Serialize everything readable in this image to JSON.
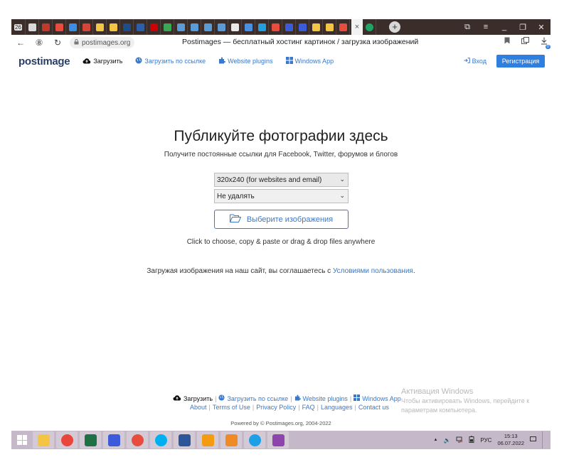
{
  "browser": {
    "tab_counter": "26",
    "tab_close": "×",
    "new_tab": "+",
    "page_title": "Postimages — бесплатный хостинг картинок / загрузка изображений",
    "url": "postimages.org",
    "nav": {
      "back": "←",
      "reader": "⑧",
      "reload": "↻"
    },
    "window_controls": [
      "⧉",
      "≡",
      "_",
      "❐",
      "✕"
    ],
    "tabs": [
      {
        "color": "#d9d9d9"
      },
      {
        "color": "#c0392b"
      },
      {
        "color": "#e74c3c"
      },
      {
        "color": "#3b8ee8"
      },
      {
        "color": "#d44638"
      },
      {
        "color": "#f4c542"
      },
      {
        "color": "#f4c542"
      },
      {
        "color": "#1d4e89"
      },
      {
        "color": "#2b5fa8"
      },
      {
        "color": "#cc0000"
      },
      {
        "color": "#3aa757"
      },
      {
        "color": "#5b9bd5"
      },
      {
        "color": "#5b9bd5"
      },
      {
        "color": "#5b9bd5"
      },
      {
        "color": "#5b9bd5"
      },
      {
        "color": "#e8e8e8"
      },
      {
        "color": "#4a90e2"
      },
      {
        "color": "#20a0e0"
      },
      {
        "color": "#e74c3c"
      },
      {
        "color": "#3b5bdb"
      },
      {
        "color": "#3b5bdb"
      },
      {
        "color": "#f4c542"
      },
      {
        "color": "#f4c542"
      },
      {
        "color": "#e74c3c"
      }
    ],
    "next_tab_color": "#1fa463",
    "reader_bookmark": "🔖",
    "downloads_badge": "0"
  },
  "site": {
    "logo": "postimage",
    "nav": {
      "upload": "Загрузить",
      "upload_by_link": "Загрузить по ссылке",
      "plugins": "Website plugins",
      "windows_app": "Windows App"
    },
    "login": "Вход",
    "register": "Регистрация"
  },
  "main": {
    "headline": "Публикуйте фотографии здесь",
    "subhead": "Получите постоянные ссылки для Facebook, Twitter, форумов и блогов",
    "size_select": "320x240 (for websites and email)",
    "delete_select": "Не удалять",
    "choose_button": "Выберите изображения",
    "drop_hint": "Click to choose, copy & paste or drag & drop files anywhere",
    "terms_prefix": "Загружая изображения на наш сайт, вы соглашаетесь с ",
    "terms_link": "Условиями пользования",
    "terms_suffix": "."
  },
  "footer": {
    "upload": "Загрузить",
    "upload_by_link": "Загрузить по ссылке",
    "plugins": "Website plugins",
    "windows_app": "Windows App",
    "links": [
      "About",
      "Terms of Use",
      "Privacy Policy",
      "FAQ",
      "Languages",
      "Contact us"
    ],
    "powered": "Powered by © Postimages.org, 2004-2022"
  },
  "windows_activation": {
    "title": "Активация Windows",
    "line1": "Чтобы активировать Windows, перейдите к",
    "line2": "параметрам компьютера."
  },
  "taskbar": {
    "apps": [
      {
        "name": "file-explorer",
        "color": "#f4c542"
      },
      {
        "name": "chrome",
        "color": "#e8453c"
      },
      {
        "name": "excel",
        "color": "#1e7145"
      },
      {
        "name": "network-tool",
        "color": "#3b5bdb"
      },
      {
        "name": "yandex-browser",
        "color": "#e74c3c"
      },
      {
        "name": "skype",
        "color": "#00aff0"
      },
      {
        "name": "word-pad",
        "color": "#2b579a"
      },
      {
        "name": "rss-reader",
        "color": "#f39c12"
      },
      {
        "name": "foxit-reader",
        "color": "#f08a24"
      },
      {
        "name": "internet-explorer",
        "color": "#1ea0e6"
      },
      {
        "name": "winrar",
        "color": "#8e44ad"
      }
    ],
    "tray": {
      "up_arrow": "▲",
      "volume": "🔊",
      "lang": "РУС",
      "time": "15:13",
      "date": "06.07.2022"
    }
  }
}
